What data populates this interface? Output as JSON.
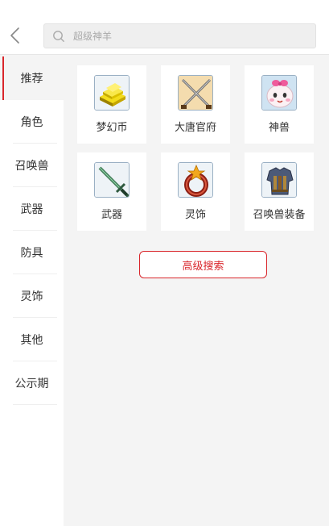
{
  "search": {
    "placeholder": "超级神羊",
    "value": ""
  },
  "sidebar": {
    "items": [
      {
        "label": "推荐",
        "active": true
      },
      {
        "label": "角色",
        "active": false
      },
      {
        "label": "召唤兽",
        "active": false
      },
      {
        "label": "武器",
        "active": false
      },
      {
        "label": "防具",
        "active": false
      },
      {
        "label": "灵饰",
        "active": false
      },
      {
        "label": "其他",
        "active": false
      },
      {
        "label": "公示期",
        "active": false
      }
    ]
  },
  "grid": {
    "items": [
      {
        "label": "梦幻币",
        "icon": "gold-bars-icon"
      },
      {
        "label": "大唐官府",
        "icon": "crossed-swords-icon"
      },
      {
        "label": "神兽",
        "icon": "divine-beast-icon"
      },
      {
        "label": "武器",
        "icon": "sword-icon"
      },
      {
        "label": "灵饰",
        "icon": "ring-icon"
      },
      {
        "label": "召唤兽装备",
        "icon": "armor-icon"
      }
    ]
  },
  "advanced_search": {
    "label": "高级搜索"
  },
  "colors": {
    "accent": "#d9262b",
    "background": "#f4f4f4",
    "surface": "#ffffff"
  }
}
